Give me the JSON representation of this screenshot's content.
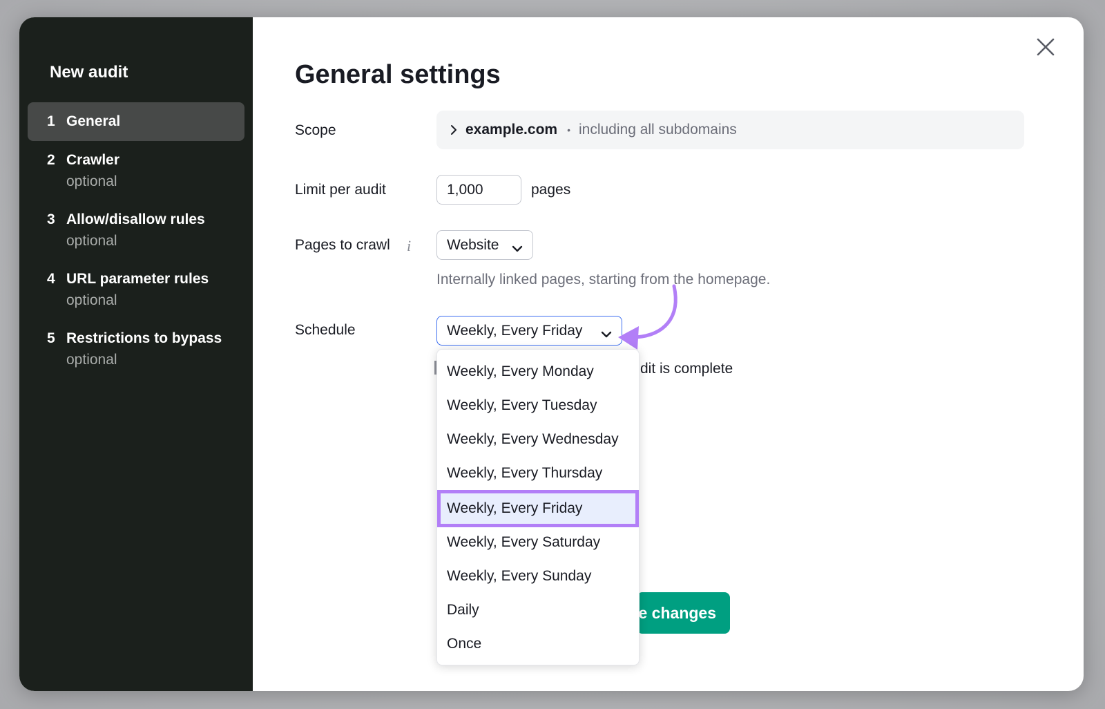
{
  "sidebar": {
    "title": "New audit",
    "steps": [
      {
        "num": "1",
        "label": "General",
        "sub": ""
      },
      {
        "num": "2",
        "label": "Crawler",
        "sub": "optional"
      },
      {
        "num": "3",
        "label": "Allow/disallow rules",
        "sub": "optional"
      },
      {
        "num": "4",
        "label": "URL parameter rules",
        "sub": "optional"
      },
      {
        "num": "5",
        "label": "Restrictions to bypass",
        "sub": "optional"
      }
    ]
  },
  "main": {
    "title": "General settings",
    "scope": {
      "label": "Scope",
      "domain": "example.com",
      "dot": "•",
      "note": "including all subdomains"
    },
    "limit": {
      "label": "Limit per audit",
      "value": "1,000",
      "unit": "pages"
    },
    "pages_to_crawl": {
      "label": "Pages to crawl",
      "info": "i",
      "selected": "Website",
      "helper": "Internally linked pages, starting from the homepage."
    },
    "schedule": {
      "label": "Schedule",
      "selected": "Weekly, Every Friday",
      "options": [
        "Weekly, Every Monday",
        "Weekly, Every Tuesday",
        "Weekly, Every Wednesday",
        "Weekly, Every Thursday",
        "Weekly, Every Friday",
        "Weekly, Every Saturday",
        "Weekly, Every Sunday",
        "Daily",
        "Once"
      ]
    },
    "partial_notify_text": "dit is complete",
    "save_button_partial": "e changes"
  },
  "colors": {
    "sidebar_bg": "#1b201c",
    "save_green": "#009f81",
    "highlight_purple": "#b27ff7",
    "focus_blue": "#3b6df0"
  },
  "icons": {
    "close": "close-icon",
    "chevron": "chevron-down-icon",
    "scope_chevron": "chevron-right-icon",
    "info": "info-icon"
  }
}
